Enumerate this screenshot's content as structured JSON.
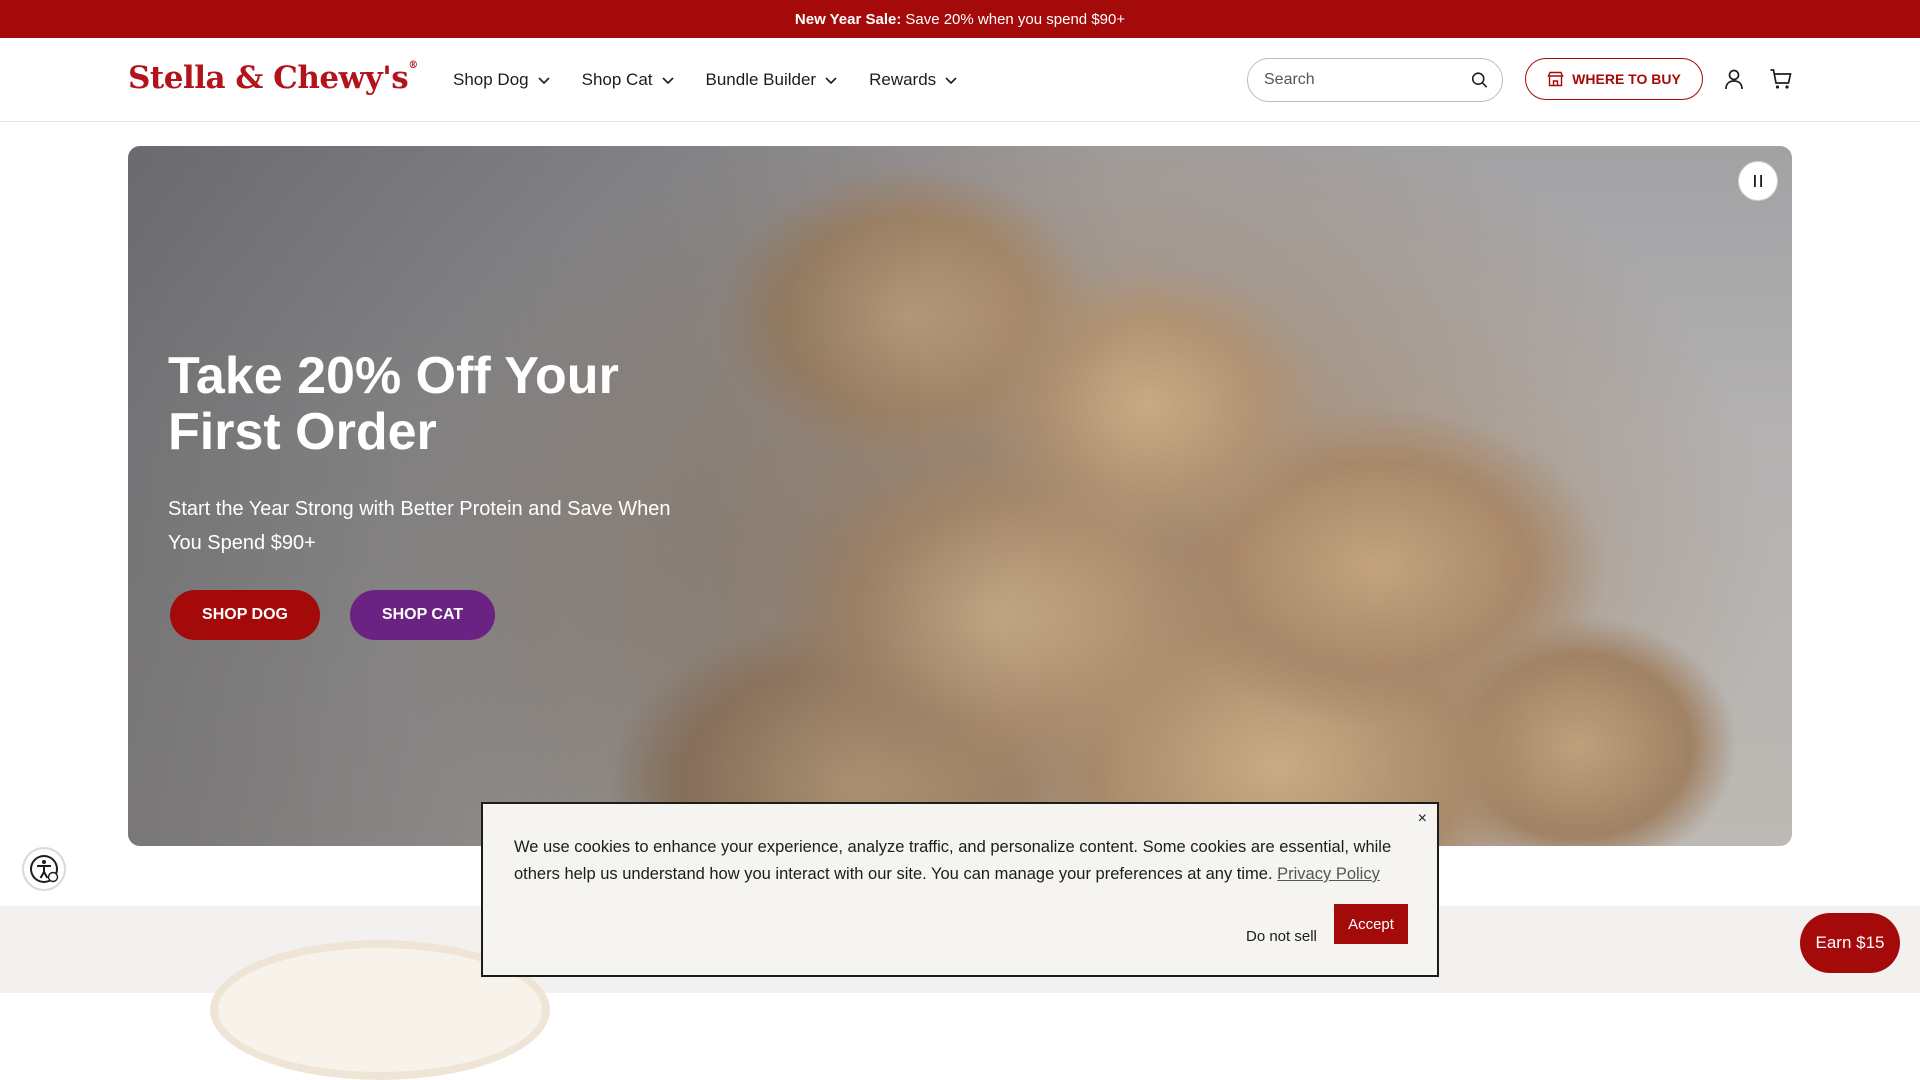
{
  "announcement": {
    "bold": "New Year Sale:",
    "text": "Save 20% when you spend $90+"
  },
  "header": {
    "logo": "Stella & Chewy's",
    "logo_mark": "®",
    "nav": [
      {
        "label": "Shop Dog"
      },
      {
        "label": "Shop Cat"
      },
      {
        "label": "Bundle Builder"
      },
      {
        "label": "Rewards"
      }
    ],
    "search_placeholder": "Search",
    "where_to_buy": "WHERE TO BUY"
  },
  "hero": {
    "title": "Take 20% Off Your First Order",
    "subtitle": "Start the Year Strong with Better Protein and Save When You Spend $90+",
    "shop_dog": "SHOP DOG",
    "shop_cat": "SHOP CAT"
  },
  "cookie": {
    "text": "We use cookies to enhance your experience, analyze traffic, and personalize content. Some cookies are essential, while others help us understand how you interact with our site. You can manage your preferences at any time.",
    "privacy_link": "Privacy Policy",
    "do_not_sell": "Do not sell",
    "accept": "Accept",
    "close": "×"
  },
  "earn": {
    "label": "Earn $15"
  },
  "colors": {
    "brand_red": "#a50a0a",
    "cat_purple": "#6b2383"
  }
}
